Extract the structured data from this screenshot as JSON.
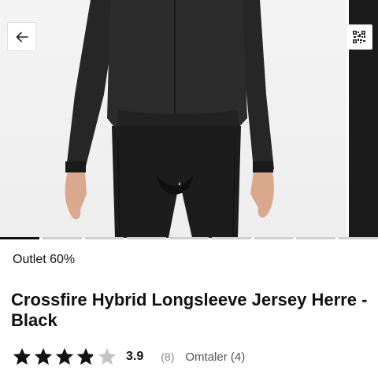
{
  "gallery": {
    "image_count": 9,
    "active_index": 0
  },
  "icons": {
    "back": "arrow-left-icon",
    "qr": "qr-code-icon",
    "star": "star-icon"
  },
  "product": {
    "badge": "Outlet 60%",
    "title": "Crossfire Hybrid Longsleeve Jersey Herre - Black",
    "rating": {
      "value": "3.9",
      "max": 5,
      "count": "(8)",
      "reviews_link": "Omtaler (4)"
    }
  },
  "colors": {
    "star_filled": "#111111",
    "star_empty": "#c4c4c4",
    "pager_active": "#111111",
    "pager_inactive": "#cfcfcf"
  }
}
